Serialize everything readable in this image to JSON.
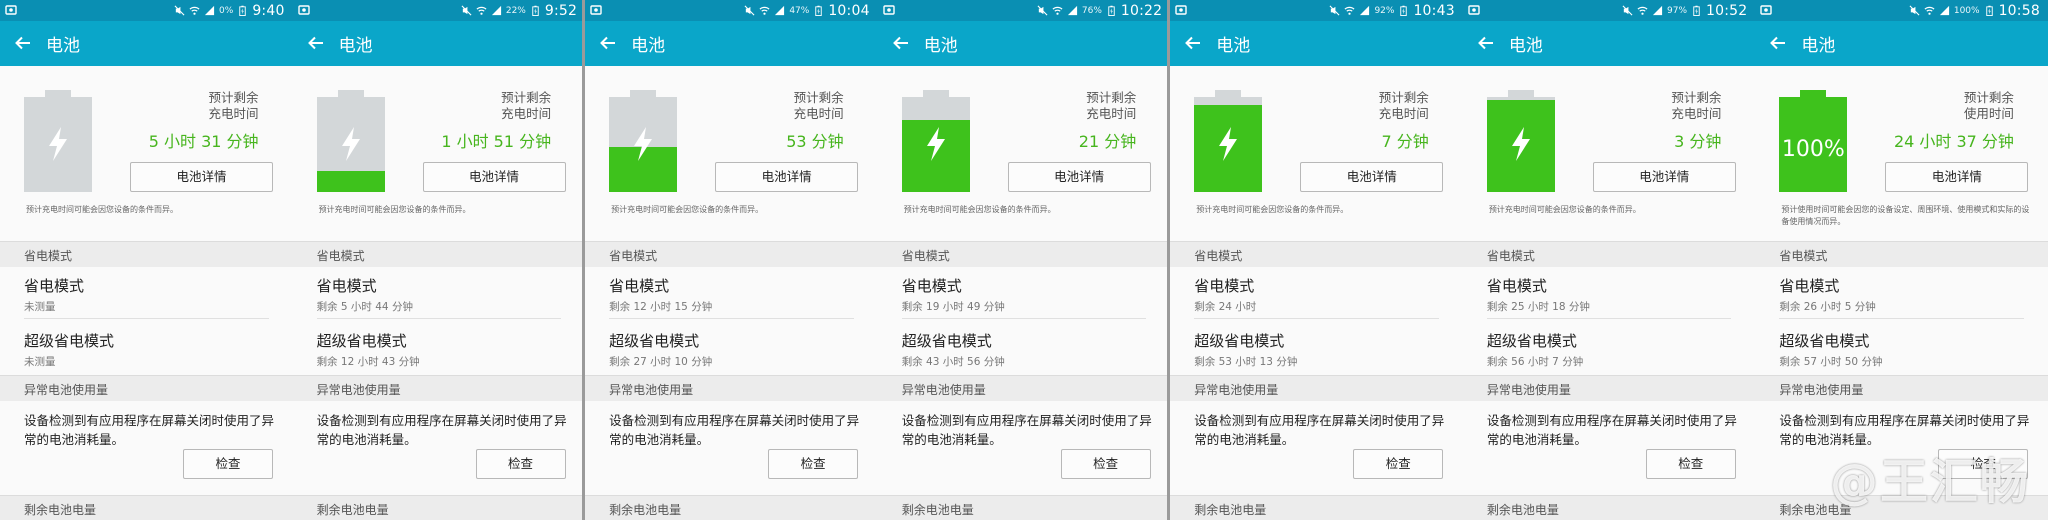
{
  "app_title": "电池",
  "labels": {
    "detail_button": "电池详情",
    "section_power_saving": "省电模式",
    "item_power_saving": "省电模式",
    "item_ultra_power_saving": "超级省电模式",
    "section_abnormal": "异常电池使用量",
    "abnormal_text": "设备检测到有应用程序在屏幕关闭时使用了异常的电池消耗量。",
    "check_button": "检查",
    "section_remaining": "剩余电池电量",
    "charge_note": "预计充电时间可能会因您设备的条件而异。"
  },
  "colors": {
    "status_bar": "#0a8fb3",
    "app_bar": "#0aa6c9",
    "battery_green": "#3ec21c",
    "value_green": "#47b51e"
  },
  "watermark": "@王汇畅",
  "panels": [
    {
      "time": "9:40",
      "status_pct": "0%",
      "charge_level": 0.0,
      "est_label": "预计剩余\n充电时间",
      "est_value": "5 小时 31 分钟",
      "note": "预计充电时间可能会因您设备的条件而异。",
      "power_saving_sub": "未测量",
      "ultra_sub": "未测量"
    },
    {
      "time": "9:52",
      "status_pct": "22%",
      "charge_level": 0.22,
      "est_label": "预计剩余\n充电时间",
      "est_value": "1 小时 51 分钟",
      "note": "预计充电时间可能会因您设备的条件而异。",
      "power_saving_sub": "剩余 5 小时 44 分钟",
      "ultra_sub": "剩余 12 小时 43 分钟"
    },
    {
      "time": "10:04",
      "status_pct": "47%",
      "charge_level": 0.47,
      "est_label": "预计剩余\n充电时间",
      "est_value": "53 分钟",
      "note": "预计充电时间可能会因您设备的条件而异。",
      "power_saving_sub": "剩余 12 小时 15 分钟",
      "ultra_sub": "剩余 27 小时 10 分钟"
    },
    {
      "time": "10:22",
      "status_pct": "76%",
      "charge_level": 0.76,
      "est_label": "预计剩余\n充电时间",
      "est_value": "21 分钟",
      "note": "预计充电时间可能会因您设备的条件而异。",
      "power_saving_sub": "剩余 19 小时 49 分钟",
      "ultra_sub": "剩余 43 小时 56 分钟"
    },
    {
      "time": "10:43",
      "status_pct": "92%",
      "charge_level": 0.92,
      "est_label": "预计剩余\n充电时间",
      "est_value": "7 分钟",
      "note": "预计充电时间可能会因您设备的条件而异。",
      "power_saving_sub": "剩余 24 小时",
      "ultra_sub": "剩余 53 小时 13 分钟"
    },
    {
      "time": "10:52",
      "status_pct": "97%",
      "charge_level": 0.97,
      "est_label": "预计剩余\n充电时间",
      "est_value": "3 分钟",
      "note": "预计充电时间可能会因您设备的条件而异。",
      "power_saving_sub": "剩余 25 小时 18 分钟",
      "ultra_sub": "剩余 56 小时 7 分钟"
    },
    {
      "time": "10:58",
      "status_pct": "100%",
      "charge_level": 1.0,
      "battery_text": "100%",
      "est_label": "预计剩余\n使用时间",
      "est_value": "24 小时 37 分钟",
      "note": "预计使用时间可能会因您的设备设定、周围环境、使用模式和实际的设备使用情况而异。",
      "power_saving_sub": "剩余 26 小时 5 分钟",
      "ultra_sub": "剩余 57 小时 50 分钟"
    }
  ]
}
